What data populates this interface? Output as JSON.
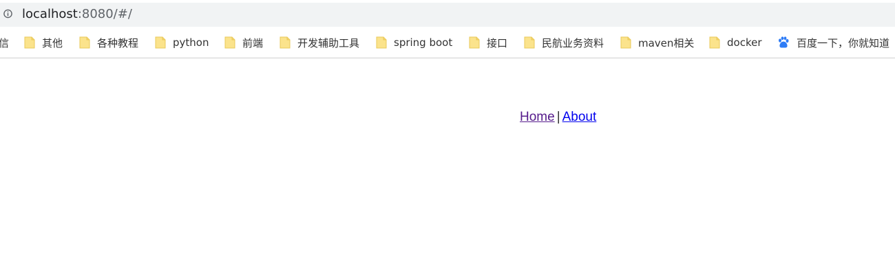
{
  "address_bar": {
    "url_host": "localhost",
    "url_rest": ":8080/#/",
    "info_icon": "info-icon"
  },
  "bookmarks": [
    {
      "label": "信",
      "icon": "none"
    },
    {
      "label": "其他",
      "icon": "folder-icon"
    },
    {
      "label": "各种教程",
      "icon": "folder-icon"
    },
    {
      "label": "python",
      "icon": "folder-icon"
    },
    {
      "label": "前端",
      "icon": "folder-icon"
    },
    {
      "label": "开发辅助工具",
      "icon": "folder-icon"
    },
    {
      "label": "spring boot",
      "icon": "folder-icon"
    },
    {
      "label": "接口",
      "icon": "folder-icon"
    },
    {
      "label": "民航业务资料",
      "icon": "folder-icon"
    },
    {
      "label": "maven相关",
      "icon": "folder-icon"
    },
    {
      "label": "docker",
      "icon": "folder-icon"
    },
    {
      "label": "百度一下，你就知道",
      "icon": "baidu-paw-icon"
    }
  ],
  "page": {
    "nav": {
      "home_label": "Home",
      "separator": "|",
      "about_label": "About"
    }
  },
  "colors": {
    "address_bar_bg": "#f1f3f4",
    "folder_yellow": "#fbe38c",
    "baidu_blue": "#2e7cf6",
    "visited_link": "#551a8b",
    "link": "#0000ee"
  }
}
